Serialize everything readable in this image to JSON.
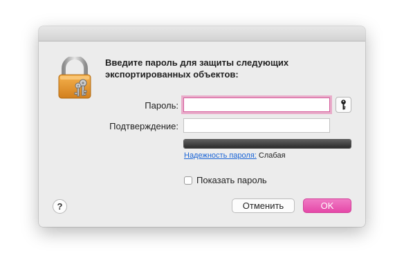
{
  "dialog": {
    "message": "Введите пароль для защиты следующих экспортированных объектов:",
    "password_label": "Пароль:",
    "password_value": "",
    "confirm_label": "Подтверждение:",
    "confirm_value": "",
    "strength": {
      "link_label": "Надежность пароля:",
      "value": "Слабая",
      "level": 1.0
    },
    "show_password_label": "Показать пароль",
    "show_password_checked": false,
    "help_label": "?",
    "cancel_label": "Отменить",
    "ok_label": "OK"
  },
  "icons": {
    "lock": "lock-with-keys-icon",
    "key": "key-icon"
  },
  "colors": {
    "accent": "#e548a8",
    "focus_ring": "#e878af",
    "link": "#1a64d6"
  }
}
